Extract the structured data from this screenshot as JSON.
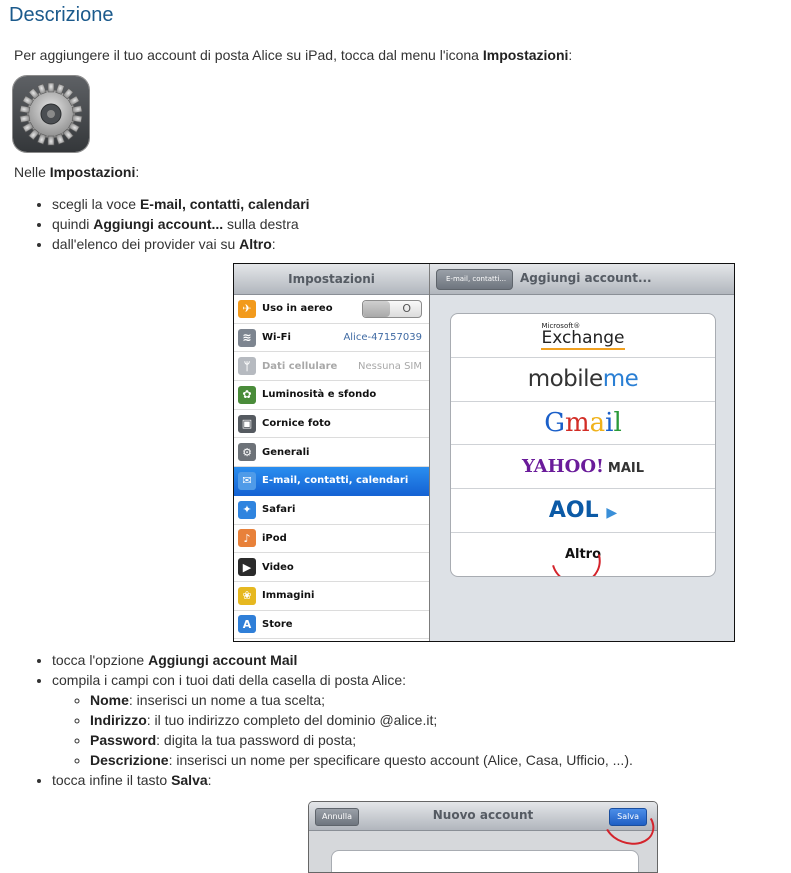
{
  "page": {
    "title": "Descrizione",
    "intro_prefix": "Per aggiungere il tuo account di posta Alice su iPad, tocca dal menu l'icona ",
    "intro_bold": "Impostazioni",
    "intro_suffix": ":",
    "nelle_prefix": "Nelle ",
    "nelle_bold": "Impostazioni",
    "nelle_suffix": ":"
  },
  "steps1": [
    {
      "pre": "scegli la voce ",
      "bold": "E-mail, contatti, calendari",
      "post": ""
    },
    {
      "pre": "quindi ",
      "bold": "Aggiungi account...",
      "post": " sulla destra"
    },
    {
      "pre": "dall'elenco dei provider vai su ",
      "bold": "Altro",
      "post": ":"
    }
  ],
  "ipad1": {
    "left_title": "Impostazioni",
    "right_title": "Aggiungi account...",
    "back_label": "E-mail, contatti...",
    "settings": [
      {
        "label": "Uso in aereo",
        "value": "",
        "icon": "airplane-icon",
        "color": "#f29a1c"
      },
      {
        "label": "Wi-Fi",
        "value": "Alice-47157039",
        "icon": "wifi-icon",
        "color": "#7d8590"
      },
      {
        "label": "Dati cellulare",
        "value": "Nessuna SIM",
        "icon": "cellular-icon",
        "color": "#b6bac0"
      },
      {
        "label": "Luminosità e sfondo",
        "value": "",
        "icon": "brightness-icon",
        "color": "#4a8c3a"
      },
      {
        "label": "Cornice foto",
        "value": "",
        "icon": "photo-frame-icon",
        "color": "#555a60"
      },
      {
        "label": "Generali",
        "value": "",
        "icon": "gear-icon",
        "color": "#6d7278"
      },
      {
        "label": "E-mail, contatti, calendari",
        "value": "",
        "icon": "mail-icon",
        "color": "#4f9be8"
      },
      {
        "label": "Safari",
        "value": "",
        "icon": "compass-icon",
        "color": "#2f84df"
      },
      {
        "label": "iPod",
        "value": "",
        "icon": "music-icon",
        "color": "#e8813a"
      },
      {
        "label": "Video",
        "value": "",
        "icon": "video-icon",
        "color": "#2b2b2b"
      },
      {
        "label": "Immagini",
        "value": "",
        "icon": "sunflower-icon",
        "color": "#e6b820"
      },
      {
        "label": "Store",
        "value": "",
        "icon": "app-store-icon",
        "color": "#2f7fd8"
      }
    ],
    "toggle_off": "O",
    "providers": {
      "exchange_top": "Microsoft®",
      "exchange": "Exchange",
      "mobile": "mobile",
      "me": "me",
      "gmail": [
        "G",
        "m",
        "a",
        "i",
        "l"
      ],
      "yahoo": "YAHOO!",
      "yahoo_mail": "MAIL",
      "aol": "AOL",
      "aol_mark": "▶",
      "altro": "Altro"
    }
  },
  "steps2": [
    {
      "pre": "tocca l'opzione ",
      "bold": "Aggiungi account Mail",
      "post": ""
    },
    {
      "pre": "compila i campi con i tuoi dati della casella di posta Alice:",
      "bold": "",
      "post": ""
    }
  ],
  "fields": [
    {
      "bold": "Nome",
      "text": ": inserisci un nome a tua scelta;"
    },
    {
      "bold": "Indirizzo",
      "text": ": il tuo indirizzo completo del dominio @alice.it;"
    },
    {
      "bold": "Password",
      "text": ": digita la tua password di posta;"
    },
    {
      "bold": "Descrizione",
      "text": ": inserisci un nome per specificare questo account (Alice, Casa, Ufficio, ...)."
    }
  ],
  "step_final": {
    "pre": "tocca infine il tasto ",
    "bold": "Salva",
    "post": ":"
  },
  "ipad2": {
    "cancel": "Annulla",
    "title": "Nuovo account",
    "save": "Salva"
  },
  "colors": {
    "title": "#1b5a8c",
    "selected_row": "#1a74e0",
    "highlight_circle": "#d4242c"
  }
}
